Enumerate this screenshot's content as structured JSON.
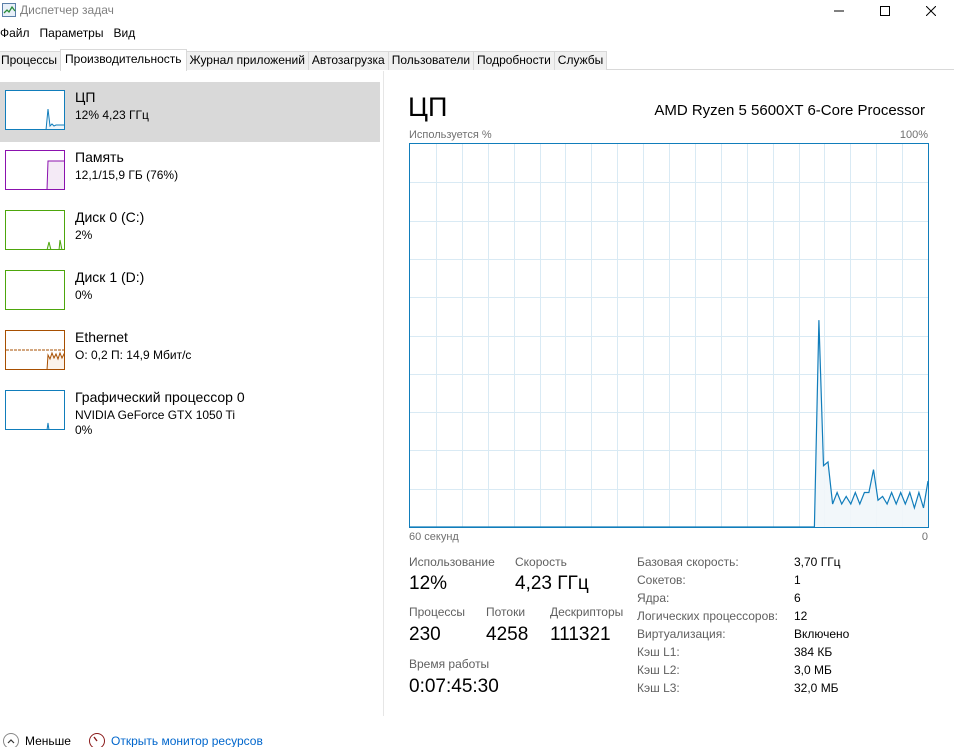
{
  "window": {
    "title": "Диспетчер задач"
  },
  "menu": [
    "Файл",
    "Параметры",
    "Вид"
  ],
  "tabs": [
    {
      "label": "Процессы",
      "active": false
    },
    {
      "label": "Производительность",
      "active": true
    },
    {
      "label": "Журнал приложений",
      "active": false
    },
    {
      "label": "Автозагрузка",
      "active": false
    },
    {
      "label": "Пользователи",
      "active": false
    },
    {
      "label": "Подробности",
      "active": false
    },
    {
      "label": "Службы",
      "active": false
    }
  ],
  "sidebar": {
    "items": [
      {
        "name": "ЦП",
        "sub1": "12%  4,23 ГГц",
        "sub2": "",
        "color": "#117dbb",
        "fill": "#f1f6fa",
        "selected": true
      },
      {
        "name": "Память",
        "sub1": "12,1/15,9 ГБ (76%)",
        "sub2": "",
        "color": "#8b12ae",
        "fill": "#f4eaf6",
        "selected": false
      },
      {
        "name": "Диск 0 (C:)",
        "sub1": "2%",
        "sub2": "",
        "color": "#4da60c",
        "fill": "#eff7ea",
        "selected": false
      },
      {
        "name": "Диск 1 (D:)",
        "sub1": "0%",
        "sub2": "",
        "color": "#4da60c",
        "fill": "#eff7ea",
        "selected": false
      },
      {
        "name": "Ethernet",
        "sub1": "О: 0,2  П: 14,9 Мбит/с",
        "sub2": "",
        "color": "#a74f01",
        "fill": "#fbf2ea",
        "selected": false
      },
      {
        "name": "Графический процессор 0",
        "sub1": "NVIDIA GeForce GTX 1050 Ti",
        "sub2": "0%",
        "color": "#117dbb",
        "fill": "#f1f6fa",
        "selected": false
      }
    ]
  },
  "main": {
    "title": "ЦП",
    "processor": "AMD Ryzen 5 5600XT 6-Core Processor",
    "graph_label_left": "Используется %",
    "graph_label_right": "100%",
    "graph_bottom_left": "60 секунд",
    "graph_bottom_right": "0",
    "usage_series": [
      0,
      0,
      0,
      0,
      0,
      0,
      0,
      0,
      0,
      0,
      0,
      0,
      0,
      0,
      0,
      0,
      0,
      0,
      0,
      0,
      0,
      0,
      0,
      0,
      0,
      0,
      0,
      0,
      0,
      0,
      0,
      0,
      0,
      0,
      0,
      0,
      0,
      0,
      0,
      0,
      0,
      0,
      0,
      0,
      0,
      0,
      0,
      0,
      0,
      0,
      0,
      0,
      0,
      0,
      0,
      0,
      0,
      0,
      0,
      0,
      0,
      0,
      0,
      0,
      0,
      0,
      0,
      0,
      0,
      0,
      0,
      0,
      0,
      0,
      0,
      0,
      0,
      0,
      0,
      0,
      0,
      0,
      0,
      0,
      0,
      0,
      0,
      0,
      0,
      0,
      54,
      16,
      17,
      6,
      9,
      6,
      8,
      6,
      9,
      6,
      9,
      9,
      15,
      7,
      8,
      6,
      9,
      6,
      9,
      6,
      9,
      5,
      9,
      5,
      12
    ],
    "stats": {
      "usage_label": "Использование",
      "usage_value": "12%",
      "speed_label": "Скорость",
      "speed_value": "4,23 ГГц",
      "processes_label": "Процессы",
      "processes_value": "230",
      "threads_label": "Потоки",
      "threads_value": "4258",
      "handles_label": "Дескрипторы",
      "handles_value": "111321",
      "uptime_label": "Время работы",
      "uptime_value": "0:07:45:30"
    },
    "specs": [
      {
        "label": "Базовая скорость:",
        "value": "3,70 ГГц"
      },
      {
        "label": "Сокетов:",
        "value": "1"
      },
      {
        "label": "Ядра:",
        "value": "6"
      },
      {
        "label": "Логических процессоров:",
        "value": "12"
      },
      {
        "label": "Виртуализация:",
        "value": "Включено"
      },
      {
        "label": "Кэш L1:",
        "value": "384 КБ"
      },
      {
        "label": "Кэш L2:",
        "value": "3,0 МБ"
      },
      {
        "label": "Кэш L3:",
        "value": "32,0 МБ"
      }
    ],
    "accent": "#117dbb"
  },
  "footer": {
    "less_label": "Меньше",
    "resmon_label": "Открыть монитор ресурсов"
  }
}
